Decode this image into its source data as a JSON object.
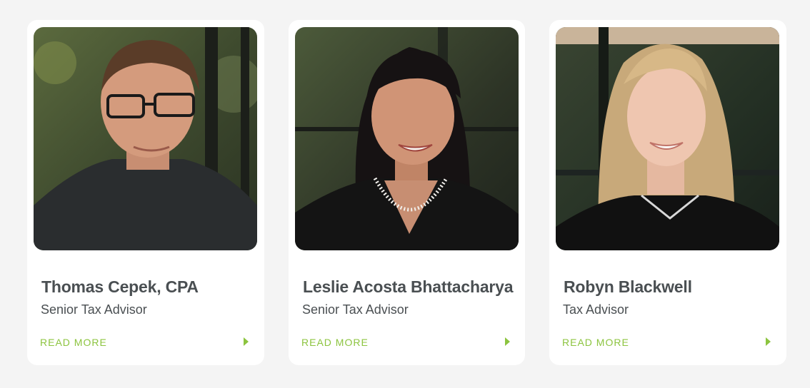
{
  "accent_color": "#8cc43f",
  "team": [
    {
      "name": "Thomas Cepek, CPA",
      "title": "Senior Tax Advisor",
      "link_label": "READ MORE",
      "arrow_icon": "caret-right-icon"
    },
    {
      "name": "Leslie Acosta Bhattacharya",
      "title": "Senior Tax Advisor",
      "link_label": "READ MORE",
      "arrow_icon": "caret-right-icon"
    },
    {
      "name": "Robyn Blackwell",
      "title": "Tax Advisor",
      "link_label": "READ MORE",
      "arrow_icon": "caret-right-icon"
    }
  ]
}
